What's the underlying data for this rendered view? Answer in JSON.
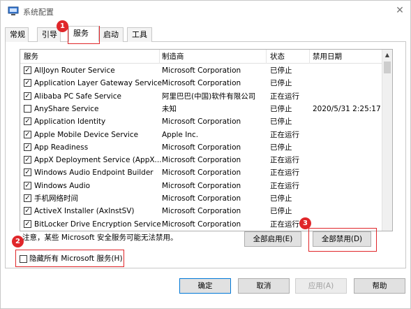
{
  "window": {
    "title": "系统配置",
    "close_icon": "close-icon"
  },
  "tabs": [
    {
      "label": "常规",
      "active": false
    },
    {
      "label": "引导",
      "active": false
    },
    {
      "label": "服务",
      "active": true
    },
    {
      "label": "启动",
      "active": false
    },
    {
      "label": "工具",
      "active": false
    }
  ],
  "services": {
    "columns": [
      "服务",
      "制造商",
      "状态",
      "禁用日期"
    ],
    "rows": [
      {
        "checked": true,
        "name": "AllJoyn Router Service",
        "manufacturer": "Microsoft Corporation",
        "status": "已停止",
        "disabled_date": ""
      },
      {
        "checked": true,
        "name": "Application Layer Gateway Service",
        "manufacturer": "Microsoft Corporation",
        "status": "已停止",
        "disabled_date": ""
      },
      {
        "checked": true,
        "name": "Alibaba PC Safe Service",
        "manufacturer": "阿里巴巴(中国)软件有限公司",
        "status": "正在运行",
        "disabled_date": ""
      },
      {
        "checked": false,
        "name": "AnyShare Service",
        "manufacturer": "未知",
        "status": "已停止",
        "disabled_date": "2020/5/31 2:25:17"
      },
      {
        "checked": true,
        "name": "Application Identity",
        "manufacturer": "Microsoft Corporation",
        "status": "已停止",
        "disabled_date": ""
      },
      {
        "checked": true,
        "name": "Apple Mobile Device Service",
        "manufacturer": "Apple Inc.",
        "status": "正在运行",
        "disabled_date": ""
      },
      {
        "checked": true,
        "name": "App Readiness",
        "manufacturer": "Microsoft Corporation",
        "status": "已停止",
        "disabled_date": ""
      },
      {
        "checked": true,
        "name": "AppX Deployment Service (AppX...",
        "manufacturer": "Microsoft Corporation",
        "status": "正在运行",
        "disabled_date": ""
      },
      {
        "checked": true,
        "name": "Windows Audio Endpoint Builder",
        "manufacturer": "Microsoft Corporation",
        "status": "正在运行",
        "disabled_date": ""
      },
      {
        "checked": true,
        "name": "Windows Audio",
        "manufacturer": "Microsoft Corporation",
        "status": "正在运行",
        "disabled_date": ""
      },
      {
        "checked": true,
        "name": "手机网络时间",
        "manufacturer": "Microsoft Corporation",
        "status": "已停止",
        "disabled_date": ""
      },
      {
        "checked": true,
        "name": "ActiveX Installer (AxInstSV)",
        "manufacturer": "Microsoft Corporation",
        "status": "已停止",
        "disabled_date": ""
      },
      {
        "checked": true,
        "name": "BitLocker Drive Encryption Service",
        "manufacturer": "Microsoft Corporation",
        "status": "正在运行",
        "disabled_date": ""
      }
    ]
  },
  "note": "注意，某些 Microsoft 安全服务可能无法禁用。",
  "buttons": {
    "enable_all": "全部启用(E)",
    "disable_all": "全部禁用(D)",
    "ok": "确定",
    "cancel": "取消",
    "apply": "应用(A)",
    "help": "帮助"
  },
  "hide_ms": {
    "label": "隐藏所有 Microsoft 服务(H)",
    "checked": false
  },
  "badges": [
    "1",
    "2",
    "3"
  ],
  "colors": {
    "highlight": "#e0262a",
    "accent": "#0078d7"
  }
}
